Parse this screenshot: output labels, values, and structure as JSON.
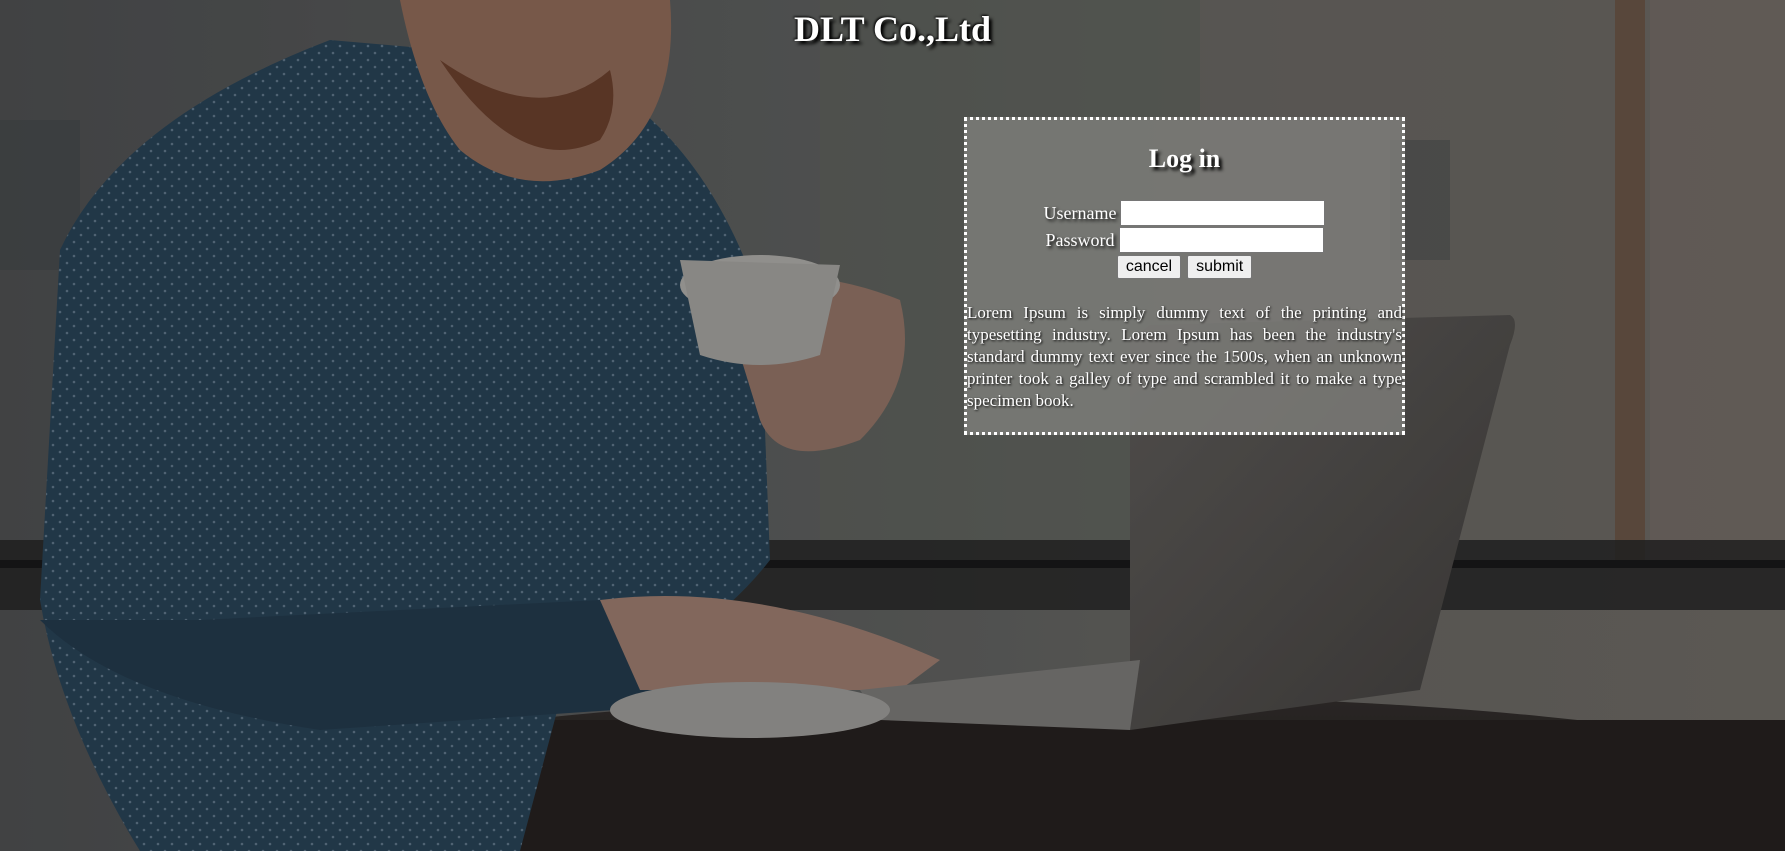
{
  "header": {
    "title": "DLT Co.,Ltd"
  },
  "login": {
    "title": "Log in",
    "username_label": "Username",
    "username_value": "",
    "password_label": "Password",
    "password_value": "",
    "cancel_label": "cancel",
    "submit_label": "submit",
    "description": "Lorem Ipsum is simply dummy text of the printing and typesetting industry. Lorem Ipsum has been the industry's standard dummy text ever since the 1500s, when an unknown printer took a galley of type and scrambled it to make a type specimen book."
  },
  "colors": {
    "title_text": "#ffffff",
    "panel_background": "#80807c",
    "panel_border": "#ffffff",
    "shirt": "#2f4d63"
  },
  "background": {
    "description_icon": "photo-man-with-laptop-and-coffee"
  }
}
